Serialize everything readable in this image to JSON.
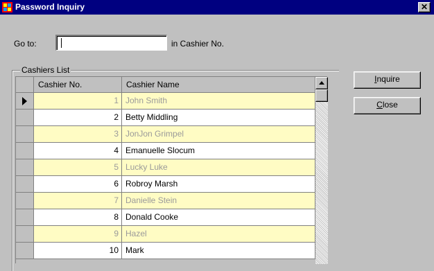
{
  "window": {
    "title": "Password Inquiry",
    "close_glyph": "✕"
  },
  "goto": {
    "label": "Go to:",
    "value": "",
    "suffix": "in Cashier No."
  },
  "group": {
    "label": "Cashiers List"
  },
  "grid": {
    "columns": [
      "Cashier No.",
      "Cashier Name"
    ],
    "current_row": 0,
    "rows": [
      {
        "no": "1",
        "name": "John Smith"
      },
      {
        "no": "2",
        "name": "Betty Middling"
      },
      {
        "no": "3",
        "name": "JonJon Grimpel"
      },
      {
        "no": "4",
        "name": "Emanuelle Slocum"
      },
      {
        "no": "5",
        "name": "Lucky Luke"
      },
      {
        "no": "6",
        "name": "Robroy Marsh"
      },
      {
        "no": "7",
        "name": "Danielle Stein"
      },
      {
        "no": "8",
        "name": "Donald Cooke"
      },
      {
        "no": "9",
        "name": "Hazel"
      },
      {
        "no": "10",
        "name": "Mark"
      }
    ]
  },
  "buttons": {
    "inquire": {
      "mnemonic": "I",
      "rest": "nquire"
    },
    "close": {
      "mnemonic": "C",
      "rest": "lose"
    }
  },
  "colors": {
    "title_bar": "#000080",
    "odd_row": "#fffcc4",
    "odd_row_text": "#9a9a9a"
  },
  "icons": {
    "app": "window-grid-icon",
    "close": "close-icon",
    "row_pointer": "row-pointer-icon",
    "scroll_up": "scroll-up-arrow-icon"
  }
}
